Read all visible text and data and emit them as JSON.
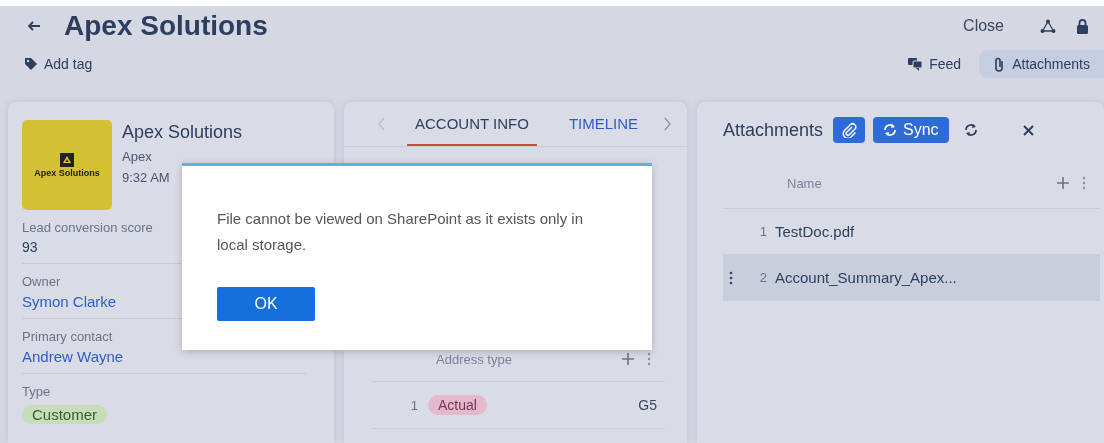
{
  "header": {
    "title": "Apex Solutions",
    "close": "Close",
    "add_tag": "Add tag"
  },
  "view_toggles": [
    {
      "label": "Feed",
      "selected": false
    },
    {
      "label": "Attachments",
      "selected": true
    }
  ],
  "account": {
    "logo_text": "Apex Solutions",
    "name": "Apex Solutions",
    "subtitle": "Apex",
    "time": "9:32 AM",
    "fields": [
      {
        "label": "Lead conversion score",
        "value": "93",
        "kind": "text"
      },
      {
        "label": "Owner",
        "value": "Symon Clarke",
        "kind": "link"
      },
      {
        "label": "Primary contact",
        "value": "Andrew Wayne",
        "kind": "link"
      },
      {
        "label": "Type",
        "value": "Customer",
        "kind": "chip"
      }
    ]
  },
  "tabs": [
    {
      "label": "ACCOUNT INFO",
      "selected": true
    },
    {
      "label": "TIMELINE",
      "selected": false
    }
  ],
  "addresses": {
    "column": "Address type",
    "rows": [
      {
        "index": "1",
        "type": "Actual",
        "column_2": "G5"
      }
    ]
  },
  "attachments": {
    "title": "Attachments",
    "sync": "Sync",
    "column": "Name",
    "rows": [
      {
        "index": "1",
        "name": "TestDoc.pdf",
        "selected": false
      },
      {
        "index": "2",
        "name": "Account_Summary_Apex...",
        "selected": true
      }
    ]
  },
  "dialog": {
    "message": "File cannot be viewed on SharePoint as it exists only in local storage.",
    "button": "OK"
  }
}
